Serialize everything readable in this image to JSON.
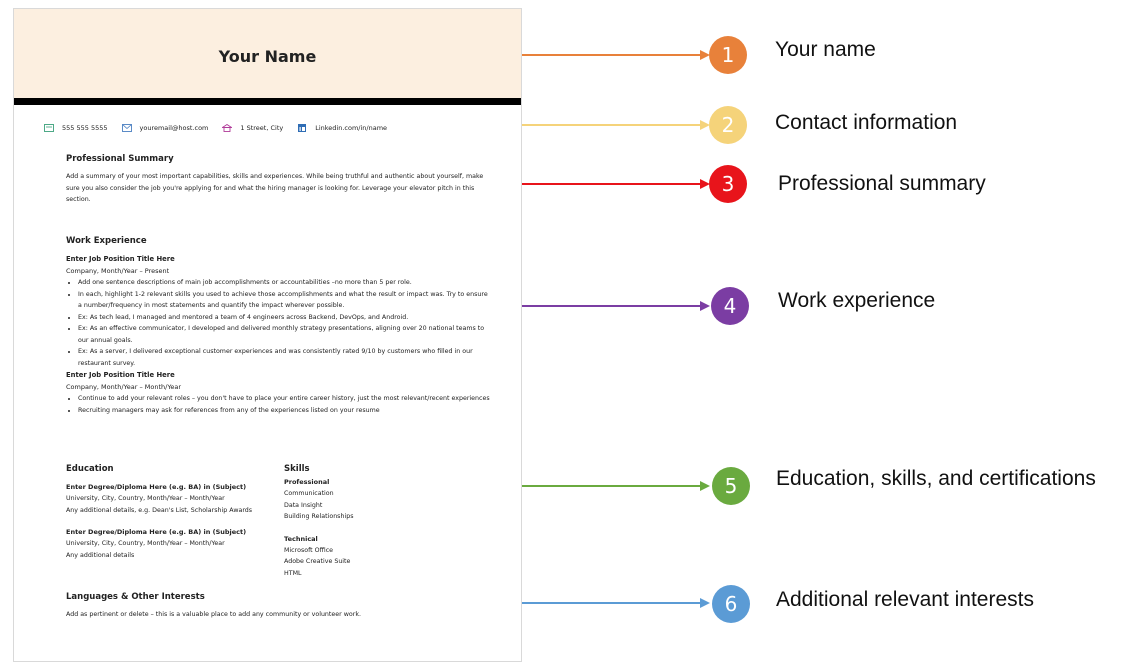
{
  "resume": {
    "name": "Your Name",
    "contact": {
      "phone": "555 555 5555",
      "email": "youremail@host.com",
      "address": "1 Street, City",
      "linkedin": "Linkedin.com/in/name"
    },
    "summary": {
      "title": "Professional Summary",
      "text": "Add a summary of your most important capabilities, skills and experiences. While being truthful and authentic about yourself, make sure you also consider the job you're applying for and what the hiring manager is looking for. Leverage your elevator pitch in this section."
    },
    "work": {
      "title": "Work Experience",
      "jobs": [
        {
          "position": "Enter Job Position Title Here",
          "meta": "Company, Month/Year – Present",
          "bullets": [
            "Add one sentence descriptions of main job accomplishments or accountabilities –no more than 5 per role.",
            "In each, highlight 1-2 relevant skills you used to achieve those accomplishments and what the result or impact was. Try to ensure a number/frequency in most statements and quantify the impact wherever possible.",
            "Ex: As tech lead, I managed and mentored a team of 4 engineers across Backend, DevOps, and Android.",
            "Ex: As an effective communicator, I developed and delivered monthly strategy presentations, aligning over 20 national teams to our annual goals.",
            "Ex: As a server, I delivered exceptional customer experiences and was consistently rated 9/10 by customers who filled in our restaurant survey."
          ]
        },
        {
          "position": "Enter Job Position Title Here",
          "meta": "Company, Month/Year – Month/Year",
          "bullets": [
            "Continue to add your relevant roles – you don't have to place your entire career history, just the most relevant/recent experiences",
            "Recruiting managers may ask for references from any of the experiences listed on your resume"
          ]
        }
      ]
    },
    "education": {
      "title": "Education",
      "entries": [
        {
          "degree": "Enter Degree/Diploma Here (e.g. BA) in (Subject)",
          "meta": "University, City, Country, Month/Year – Month/Year",
          "details": "Any additional details, e.g. Dean's List, Scholarship Awards"
        },
        {
          "degree": "Enter Degree/Diploma Here (e.g. BA) in (Subject)",
          "meta": "University, City, Country, Month/Year – Month/Year",
          "details": "Any additional details"
        }
      ]
    },
    "skills": {
      "title": "Skills",
      "groups": [
        {
          "name": "Professional",
          "items": [
            "Communication",
            "Data Insight",
            "Building Relationships"
          ]
        },
        {
          "name": "Technical",
          "items": [
            "Microsoft Office",
            "Adobe Creative Suite",
            "HTML"
          ]
        }
      ]
    },
    "interests": {
      "title": "Languages & Other Interests",
      "text": "Add as pertinent or delete – this is a valuable place to add any community or volunteer work."
    }
  },
  "callouts": [
    {
      "number": "1",
      "label": "Your name",
      "color": "#e8813a"
    },
    {
      "number": "2",
      "label": "Contact information",
      "color": "#f5d37a"
    },
    {
      "number": "3",
      "label": "Professional summary",
      "color": "#e8141b"
    },
    {
      "number": "4",
      "label": "Work experience",
      "color": "#7b3da3"
    },
    {
      "number": "5",
      "label": "Education, skills, and certifications",
      "color": "#6aaa3f"
    },
    {
      "number": "6",
      "label": "Additional relevant interests",
      "color": "#5b9bd5"
    }
  ]
}
